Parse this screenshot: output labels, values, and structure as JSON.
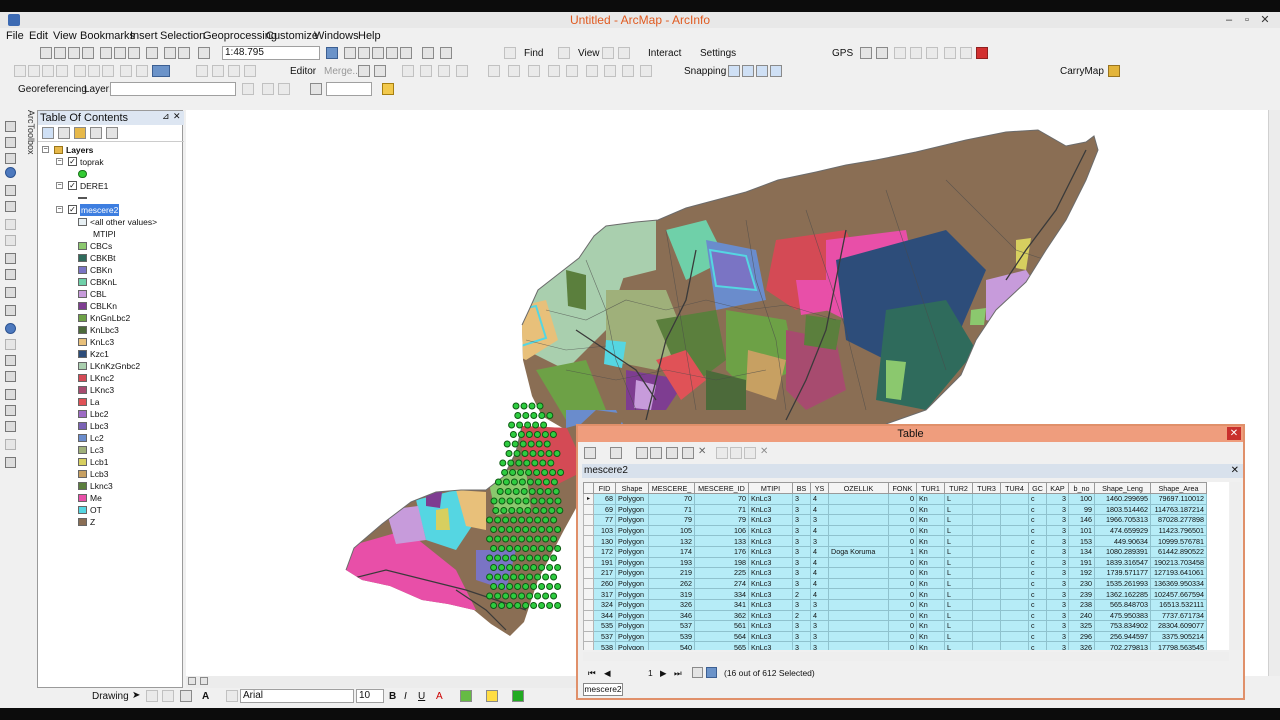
{
  "window": {
    "title": "Untitled - ArcMap - ArcInfo"
  },
  "menu": [
    "File",
    "Edit",
    "View",
    "Bookmarks",
    "Insert",
    "Selection",
    "Geoprocessing",
    "Customize",
    "Windows",
    "Help"
  ],
  "toolbar1": {
    "scale": "1:48.795",
    "find": "Find",
    "view": "View",
    "interact": "Interact",
    "settings": "Settings",
    "gps": "GPS"
  },
  "toolbar2": {
    "editor": "Editor",
    "merge": "Merge...",
    "snapping": "Snapping",
    "carrymap": "CarryMap"
  },
  "toolbar3": {
    "georef": "Georeferencing",
    "layer_label": "Layer:"
  },
  "side_tab": "ArcToolbox",
  "toc": {
    "title": "Table Of Contents",
    "layers_label": "Layers",
    "toprak": "toprak",
    "dere": "DERE1",
    "mescere": "mescere2",
    "other": "<all other values>",
    "field": "MTIPI",
    "legend": [
      {
        "label": "CBCs",
        "color": "#8bc86e"
      },
      {
        "label": "CBKBt",
        "color": "#2f6b5c"
      },
      {
        "label": "CBKn",
        "color": "#7a74c4"
      },
      {
        "label": "CBKnL",
        "color": "#6fd0a9"
      },
      {
        "label": "CBL",
        "color": "#c79bdb"
      },
      {
        "label": "CBLKn",
        "color": "#7e3d91"
      },
      {
        "label": "KnGnLbc2",
        "color": "#6da146"
      },
      {
        "label": "KnLbc3",
        "color": "#4c6a3a"
      },
      {
        "label": "KnLc3",
        "color": "#e8c07a"
      },
      {
        "label": "Kzc1",
        "color": "#2d4d7a"
      },
      {
        "label": "LKnKzGnbc2",
        "color": "#a9cfae"
      },
      {
        "label": "LKnc2",
        "color": "#d44a55"
      },
      {
        "label": "LKnc3",
        "color": "#a74b6f"
      },
      {
        "label": "La",
        "color": "#e05257"
      },
      {
        "label": "Lbc2",
        "color": "#9d6bc4"
      },
      {
        "label": "Lbc3",
        "color": "#7a62b5"
      },
      {
        "label": "Lc2",
        "color": "#6a8ccc"
      },
      {
        "label": "Lc3",
        "color": "#9fb07a"
      },
      {
        "label": "Lcb1",
        "color": "#d7cf5f"
      },
      {
        "label": "Lcb3",
        "color": "#c7a062"
      },
      {
        "label": "Lknc3",
        "color": "#5b7f3d"
      },
      {
        "label": "Me",
        "color": "#e84fa8"
      },
      {
        "label": "OT",
        "color": "#55d6e2"
      },
      {
        "label": "Z",
        "color": "#8a6e54"
      }
    ]
  },
  "table": {
    "title": "Table",
    "tab_name": "mescere2",
    "columns": [
      "FID",
      "Shape",
      "MESCERE_",
      "MESCERE_ID",
      "MTIPI",
      "BS",
      "YS",
      "OZELLIK",
      "FONK",
      "TUR1",
      "TUR2",
      "TUR3",
      "TUR4",
      "GC",
      "KAP",
      "b_no",
      "Shape_Leng",
      "Shape_Area"
    ],
    "rows": [
      [
        "68",
        "Polygon",
        "70",
        "70",
        "KnLc3",
        "3",
        "4",
        "",
        "0",
        "Kn",
        "L",
        "",
        "",
        "c",
        "3",
        "100",
        "1460.299695",
        "79697.110012"
      ],
      [
        "69",
        "Polygon",
        "71",
        "71",
        "KnLc3",
        "3",
        "4",
        "",
        "0",
        "Kn",
        "L",
        "",
        "",
        "c",
        "3",
        "99",
        "1803.514462",
        "114763.187214"
      ],
      [
        "77",
        "Polygon",
        "79",
        "79",
        "KnLc3",
        "3",
        "3",
        "",
        "0",
        "Kn",
        "L",
        "",
        "",
        "c",
        "3",
        "146",
        "1966.705313",
        "87028.277898"
      ],
      [
        "103",
        "Polygon",
        "105",
        "106",
        "KnLc3",
        "3",
        "4",
        "",
        "0",
        "Kn",
        "L",
        "",
        "",
        "c",
        "3",
        "101",
        "474.659929",
        "11423.796501"
      ],
      [
        "130",
        "Polygon",
        "132",
        "133",
        "KnLc3",
        "3",
        "3",
        "",
        "0",
        "Kn",
        "L",
        "",
        "",
        "c",
        "3",
        "153",
        "449.90634",
        "10999.576781"
      ],
      [
        "172",
        "Polygon",
        "174",
        "176",
        "KnLc3",
        "3",
        "4",
        "Doga Koruma",
        "1",
        "Kn",
        "L",
        "",
        "",
        "c",
        "3",
        "134",
        "1080.289391",
        "61442.890522"
      ],
      [
        "191",
        "Polygon",
        "193",
        "198",
        "KnLc3",
        "3",
        "4",
        "",
        "0",
        "Kn",
        "L",
        "",
        "",
        "c",
        "3",
        "191",
        "1839.316547",
        "190213.703458"
      ],
      [
        "217",
        "Polygon",
        "219",
        "225",
        "KnLc3",
        "3",
        "4",
        "",
        "0",
        "Kn",
        "L",
        "",
        "",
        "c",
        "3",
        "192",
        "1739.571177",
        "127193.641061"
      ],
      [
        "260",
        "Polygon",
        "262",
        "274",
        "KnLc3",
        "3",
        "4",
        "",
        "0",
        "Kn",
        "L",
        "",
        "",
        "c",
        "3",
        "230",
        "1535.261993",
        "136369.950334"
      ],
      [
        "317",
        "Polygon",
        "319",
        "334",
        "KnLc3",
        "2",
        "4",
        "",
        "0",
        "Kn",
        "L",
        "",
        "",
        "c",
        "3",
        "239",
        "1362.162285",
        "102457.667594"
      ],
      [
        "324",
        "Polygon",
        "326",
        "341",
        "KnLc3",
        "3",
        "3",
        "",
        "0",
        "Kn",
        "L",
        "",
        "",
        "c",
        "3",
        "238",
        "565.848703",
        "16513.532111"
      ],
      [
        "344",
        "Polygon",
        "346",
        "362",
        "KnLc3",
        "2",
        "4",
        "",
        "0",
        "Kn",
        "L",
        "",
        "",
        "c",
        "3",
        "240",
        "475.950383",
        "7737.671734"
      ],
      [
        "535",
        "Polygon",
        "537",
        "561",
        "KnLc3",
        "3",
        "3",
        "",
        "0",
        "Kn",
        "L",
        "",
        "",
        "c",
        "3",
        "325",
        "753.834902",
        "28304.609077"
      ],
      [
        "537",
        "Polygon",
        "539",
        "564",
        "KnLc3",
        "3",
        "3",
        "",
        "0",
        "Kn",
        "L",
        "",
        "",
        "c",
        "3",
        "296",
        "256.944597",
        "3375.905214"
      ],
      [
        "538",
        "Polygon",
        "540",
        "565",
        "KnLc3",
        "3",
        "3",
        "",
        "0",
        "Kn",
        "L",
        "",
        "",
        "c",
        "3",
        "326",
        "702.279813",
        "17798.563545"
      ]
    ],
    "record": "1",
    "selection_status": "(16 out of 612 Selected)"
  },
  "drawing": {
    "label": "Drawing",
    "font": "Arial",
    "size": "10"
  }
}
